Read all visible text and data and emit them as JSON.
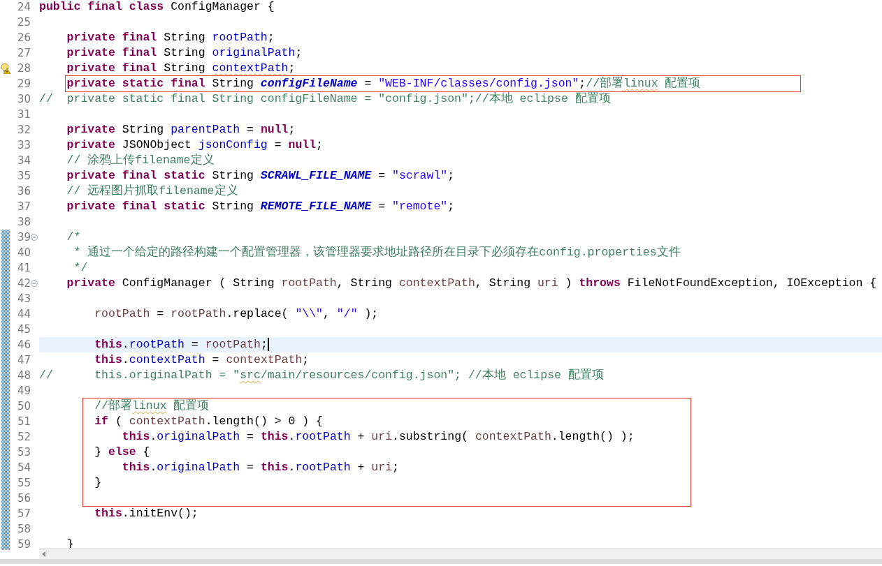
{
  "editor": {
    "lines": [
      {
        "number": "24",
        "changed": false,
        "current": false,
        "warning": false,
        "foldable": false,
        "tokens": [
          {
            "kind": "keyword",
            "text": "public final class"
          },
          {
            "kind": "plain",
            "text": " ConfigManager {"
          }
        ]
      },
      {
        "number": "25",
        "changed": false,
        "current": false,
        "warning": false,
        "foldable": false
      },
      {
        "number": "26",
        "changed": false,
        "current": false,
        "warning": false,
        "foldable": false,
        "tokens": [
          {
            "kind": "keyword",
            "text": "    private final"
          },
          {
            "kind": "plain",
            "text": " String "
          },
          {
            "kind": "field",
            "text": "rootPath"
          },
          {
            "kind": "plain",
            "text": ";"
          }
        ]
      },
      {
        "number": "27",
        "changed": false,
        "current": false,
        "warning": false,
        "foldable": false,
        "tokens": [
          {
            "kind": "keyword",
            "text": "    private final"
          },
          {
            "kind": "plain",
            "text": " String "
          },
          {
            "kind": "field",
            "text": "originalPath"
          },
          {
            "kind": "plain",
            "text": ";"
          }
        ]
      },
      {
        "number": "28",
        "changed": false,
        "current": false,
        "warning": true,
        "foldable": false,
        "tokens": [
          {
            "kind": "keyword",
            "text": "    private final"
          },
          {
            "kind": "plain",
            "text": " String "
          },
          {
            "kind": "field",
            "text": "contextPath",
            "squiggle": true
          },
          {
            "kind": "plain",
            "text": ";"
          }
        ]
      },
      {
        "kind": "box",
        "lines": [
          {
            "number": "29",
            "changed": false,
            "current": false,
            "warning": false,
            "foldable": false,
            "tokens": [
              {
                "kind": "keyword",
                "text": "    private static final"
              },
              {
                "kind": "plain",
                "text": " String "
              },
              {
                "kind": "static_field",
                "text": "configFileName"
              },
              {
                "kind": "plain",
                "text": " = "
              },
              {
                "kind": "string",
                "text": "\"WEB-INF/classes/config.json\""
              },
              {
                "kind": "plain",
                "text": ";"
              },
              {
                "kind": "comment",
                "text": "//部署"
              },
              {
                "kind": "comment",
                "text": "linux",
                "squiggle": true
              },
              {
                "kind": "comment",
                "text": " 配置项"
              }
            ]
          }
        ]
      },
      {
        "number": "30",
        "changed": false,
        "current": false,
        "warning": false,
        "foldable": false,
        "tokens": [
          {
            "kind": "comment",
            "text": "//  private static final String configFileName = \"config.json\";//本地 eclipse 配置项"
          }
        ]
      },
      {
        "number": "31",
        "changed": false,
        "current": false,
        "warning": false,
        "foldable": false
      },
      {
        "number": "32",
        "changed": false,
        "current": false,
        "warning": false,
        "foldable": false,
        "tokens": [
          {
            "kind": "keyword",
            "text": "    private"
          },
          {
            "kind": "plain",
            "text": " String "
          },
          {
            "kind": "field",
            "text": "parentPath"
          },
          {
            "kind": "plain",
            "text": " = "
          },
          {
            "kind": "keyword",
            "text": "null"
          },
          {
            "kind": "plain",
            "text": ";"
          }
        ]
      },
      {
        "number": "33",
        "changed": false,
        "current": false,
        "warning": false,
        "foldable": false,
        "tokens": [
          {
            "kind": "keyword",
            "text": "    private"
          },
          {
            "kind": "plain",
            "text": " JSONObject "
          },
          {
            "kind": "field",
            "text": "jsonConfig"
          },
          {
            "kind": "plain",
            "text": " = "
          },
          {
            "kind": "keyword",
            "text": "null"
          },
          {
            "kind": "plain",
            "text": ";"
          }
        ]
      },
      {
        "number": "34",
        "changed": false,
        "current": false,
        "warning": false,
        "foldable": false,
        "tokens": [
          {
            "kind": "comment",
            "text": "    // 涂鸦上传filename定义"
          }
        ]
      },
      {
        "number": "35",
        "changed": false,
        "current": false,
        "warning": false,
        "foldable": false,
        "tokens": [
          {
            "kind": "keyword",
            "text": "    private final static"
          },
          {
            "kind": "plain",
            "text": " String "
          },
          {
            "kind": "static_field",
            "text": "SCRAWL_FILE_NAME"
          },
          {
            "kind": "plain",
            "text": " = "
          },
          {
            "kind": "string",
            "text": "\"scrawl\""
          },
          {
            "kind": "plain",
            "text": ";"
          }
        ]
      },
      {
        "number": "36",
        "changed": false,
        "current": false,
        "warning": false,
        "foldable": false,
        "tokens": [
          {
            "kind": "comment",
            "text": "    // 远程图片抓取filename定义"
          }
        ]
      },
      {
        "number": "37",
        "changed": false,
        "current": false,
        "warning": false,
        "foldable": false,
        "tokens": [
          {
            "kind": "keyword",
            "text": "    private final static"
          },
          {
            "kind": "plain",
            "text": " String "
          },
          {
            "kind": "static_field",
            "text": "REMOTE_FILE_NAME"
          },
          {
            "kind": "plain",
            "text": " = "
          },
          {
            "kind": "string",
            "text": "\"remote\""
          },
          {
            "kind": "plain",
            "text": ";"
          }
        ]
      },
      {
        "number": "38",
        "changed": false,
        "current": false,
        "warning": false,
        "foldable": false
      },
      {
        "number": "39",
        "changed": true,
        "current": false,
        "warning": false,
        "foldable": true,
        "tokens": [
          {
            "kind": "comment",
            "text": "    /*"
          }
        ]
      },
      {
        "number": "40",
        "changed": true,
        "current": false,
        "warning": false,
        "foldable": false,
        "tokens": [
          {
            "kind": "comment",
            "text": "     * 通过一个给定的路径构建一个配置管理器，该管理器要求地址路径所在目录下必须存在config.properties文件"
          }
        ]
      },
      {
        "number": "41",
        "changed": true,
        "current": false,
        "warning": false,
        "foldable": false,
        "tokens": [
          {
            "kind": "comment",
            "text": "     */"
          }
        ]
      },
      {
        "number": "42",
        "changed": true,
        "current": false,
        "warning": false,
        "foldable": true,
        "tokens": [
          {
            "kind": "keyword",
            "text": "    private"
          },
          {
            "kind": "plain",
            "text": " ConfigManager ( String "
          },
          {
            "kind": "local",
            "text": "rootPath"
          },
          {
            "kind": "plain",
            "text": ", String "
          },
          {
            "kind": "local",
            "text": "contextPath"
          },
          {
            "kind": "plain",
            "text": ", String "
          },
          {
            "kind": "local",
            "text": "uri"
          },
          {
            "kind": "plain",
            "text": " ) "
          },
          {
            "kind": "keyword",
            "text": "throws"
          },
          {
            "kind": "plain",
            "text": " FileNotFoundException, IOException {"
          }
        ]
      },
      {
        "number": "43",
        "changed": true,
        "current": false,
        "warning": false,
        "foldable": false
      },
      {
        "number": "44",
        "changed": true,
        "current": false,
        "warning": false,
        "foldable": false,
        "tokens": [
          {
            "kind": "local",
            "text": "        rootPath"
          },
          {
            "kind": "plain",
            "text": " = "
          },
          {
            "kind": "local",
            "text": "rootPath"
          },
          {
            "kind": "plain",
            "text": ".replace( "
          },
          {
            "kind": "string",
            "text": "\"\\\\\""
          },
          {
            "kind": "plain",
            "text": ", "
          },
          {
            "kind": "string",
            "text": "\"/\""
          },
          {
            "kind": "plain",
            "text": " );"
          }
        ]
      },
      {
        "number": "45",
        "changed": true,
        "current": false,
        "warning": false,
        "foldable": false
      },
      {
        "number": "46",
        "changed": true,
        "current": true,
        "warning": false,
        "foldable": false,
        "tokens": [
          {
            "kind": "keyword",
            "text": "        this"
          },
          {
            "kind": "plain",
            "text": "."
          },
          {
            "kind": "field",
            "text": "rootPath"
          },
          {
            "kind": "plain",
            "text": " = "
          },
          {
            "kind": "local",
            "text": "rootPath"
          },
          {
            "kind": "plain",
            "text": ";"
          }
        ]
      },
      {
        "number": "47",
        "changed": true,
        "current": false,
        "warning": false,
        "foldable": false,
        "tokens": [
          {
            "kind": "keyword",
            "text": "        this"
          },
          {
            "kind": "plain",
            "text": "."
          },
          {
            "kind": "field",
            "text": "contextPath"
          },
          {
            "kind": "plain",
            "text": " = "
          },
          {
            "kind": "local",
            "text": "contextPath"
          },
          {
            "kind": "plain",
            "text": ";"
          }
        ]
      },
      {
        "number": "48",
        "changed": true,
        "current": false,
        "warning": false,
        "foldable": false,
        "tokens": [
          {
            "kind": "comment",
            "text": "//      this.originalPath = \""
          },
          {
            "kind": "comment",
            "text": "src",
            "squiggle": true
          },
          {
            "kind": "comment",
            "text": "/main/resources/config.json\"; //本地 eclipse 配置项"
          }
        ]
      },
      {
        "number": "49",
        "changed": true,
        "current": false,
        "warning": false,
        "foldable": false
      },
      {
        "kind": "box",
        "lines": [
          {
            "number": "50",
            "changed": true,
            "current": false,
            "warning": false,
            "foldable": false,
            "tokens": [
              {
                "kind": "comment",
                "text": "        //部署"
              },
              {
                "kind": "comment",
                "text": "linux",
                "squiggle": true
              },
              {
                "kind": "comment",
                "text": " 配置项"
              }
            ]
          },
          {
            "number": "51",
            "changed": true,
            "current": false,
            "warning": false,
            "foldable": false,
            "tokens": [
              {
                "kind": "keyword",
                "text": "        if"
              },
              {
                "kind": "plain",
                "text": " ( "
              },
              {
                "kind": "local",
                "text": "contextPath"
              },
              {
                "kind": "plain",
                "text": ".length() > 0 ) {"
              }
            ]
          },
          {
            "number": "52",
            "changed": true,
            "current": false,
            "warning": false,
            "foldable": false,
            "tokens": [
              {
                "kind": "keyword",
                "text": "            this"
              },
              {
                "kind": "plain",
                "text": "."
              },
              {
                "kind": "field",
                "text": "originalPath"
              },
              {
                "kind": "plain",
                "text": " = "
              },
              {
                "kind": "keyword",
                "text": "this"
              },
              {
                "kind": "plain",
                "text": "."
              },
              {
                "kind": "field",
                "text": "rootPath"
              },
              {
                "kind": "plain",
                "text": " + "
              },
              {
                "kind": "local",
                "text": "uri"
              },
              {
                "kind": "plain",
                "text": ".substring( "
              },
              {
                "kind": "local",
                "text": "contextPath"
              },
              {
                "kind": "plain",
                "text": ".length() );"
              }
            ]
          },
          {
            "number": "53",
            "changed": true,
            "current": false,
            "warning": false,
            "foldable": false,
            "tokens": [
              {
                "kind": "plain",
                "text": "        } "
              },
              {
                "kind": "keyword",
                "text": "else"
              },
              {
                "kind": "plain",
                "text": " {"
              }
            ]
          },
          {
            "number": "54",
            "changed": true,
            "current": false,
            "warning": false,
            "foldable": false,
            "tokens": [
              {
                "kind": "keyword",
                "text": "            this"
              },
              {
                "kind": "plain",
                "text": "."
              },
              {
                "kind": "field",
                "text": "originalPath"
              },
              {
                "kind": "plain",
                "text": " = "
              },
              {
                "kind": "keyword",
                "text": "this"
              },
              {
                "kind": "plain",
                "text": "."
              },
              {
                "kind": "field",
                "text": "rootPath"
              },
              {
                "kind": "plain",
                "text": " + "
              },
              {
                "kind": "local",
                "text": "uri"
              },
              {
                "kind": "plain",
                "text": ";"
              }
            ]
          },
          {
            "number": "55",
            "changed": true,
            "current": false,
            "warning": false,
            "foldable": false,
            "tokens": [
              {
                "kind": "plain",
                "text": "        }"
              }
            ]
          },
          {
            "number": "56",
            "changed": true,
            "current": false,
            "warning": false,
            "foldable": false
          }
        ]
      },
      {
        "number": "57",
        "changed": true,
        "current": false,
        "warning": false,
        "foldable": false,
        "tokens": [
          {
            "kind": "keyword",
            "text": "        this"
          },
          {
            "kind": "plain",
            "text": ".initEnv();"
          }
        ]
      },
      {
        "number": "58",
        "changed": true,
        "current": false,
        "warning": false,
        "foldable": false
      },
      {
        "number": "59",
        "changed": true,
        "current": false,
        "warning": false,
        "foldable": false,
        "tokens": [
          {
            "kind": "plain",
            "text": "    }"
          }
        ]
      }
    ]
  }
}
